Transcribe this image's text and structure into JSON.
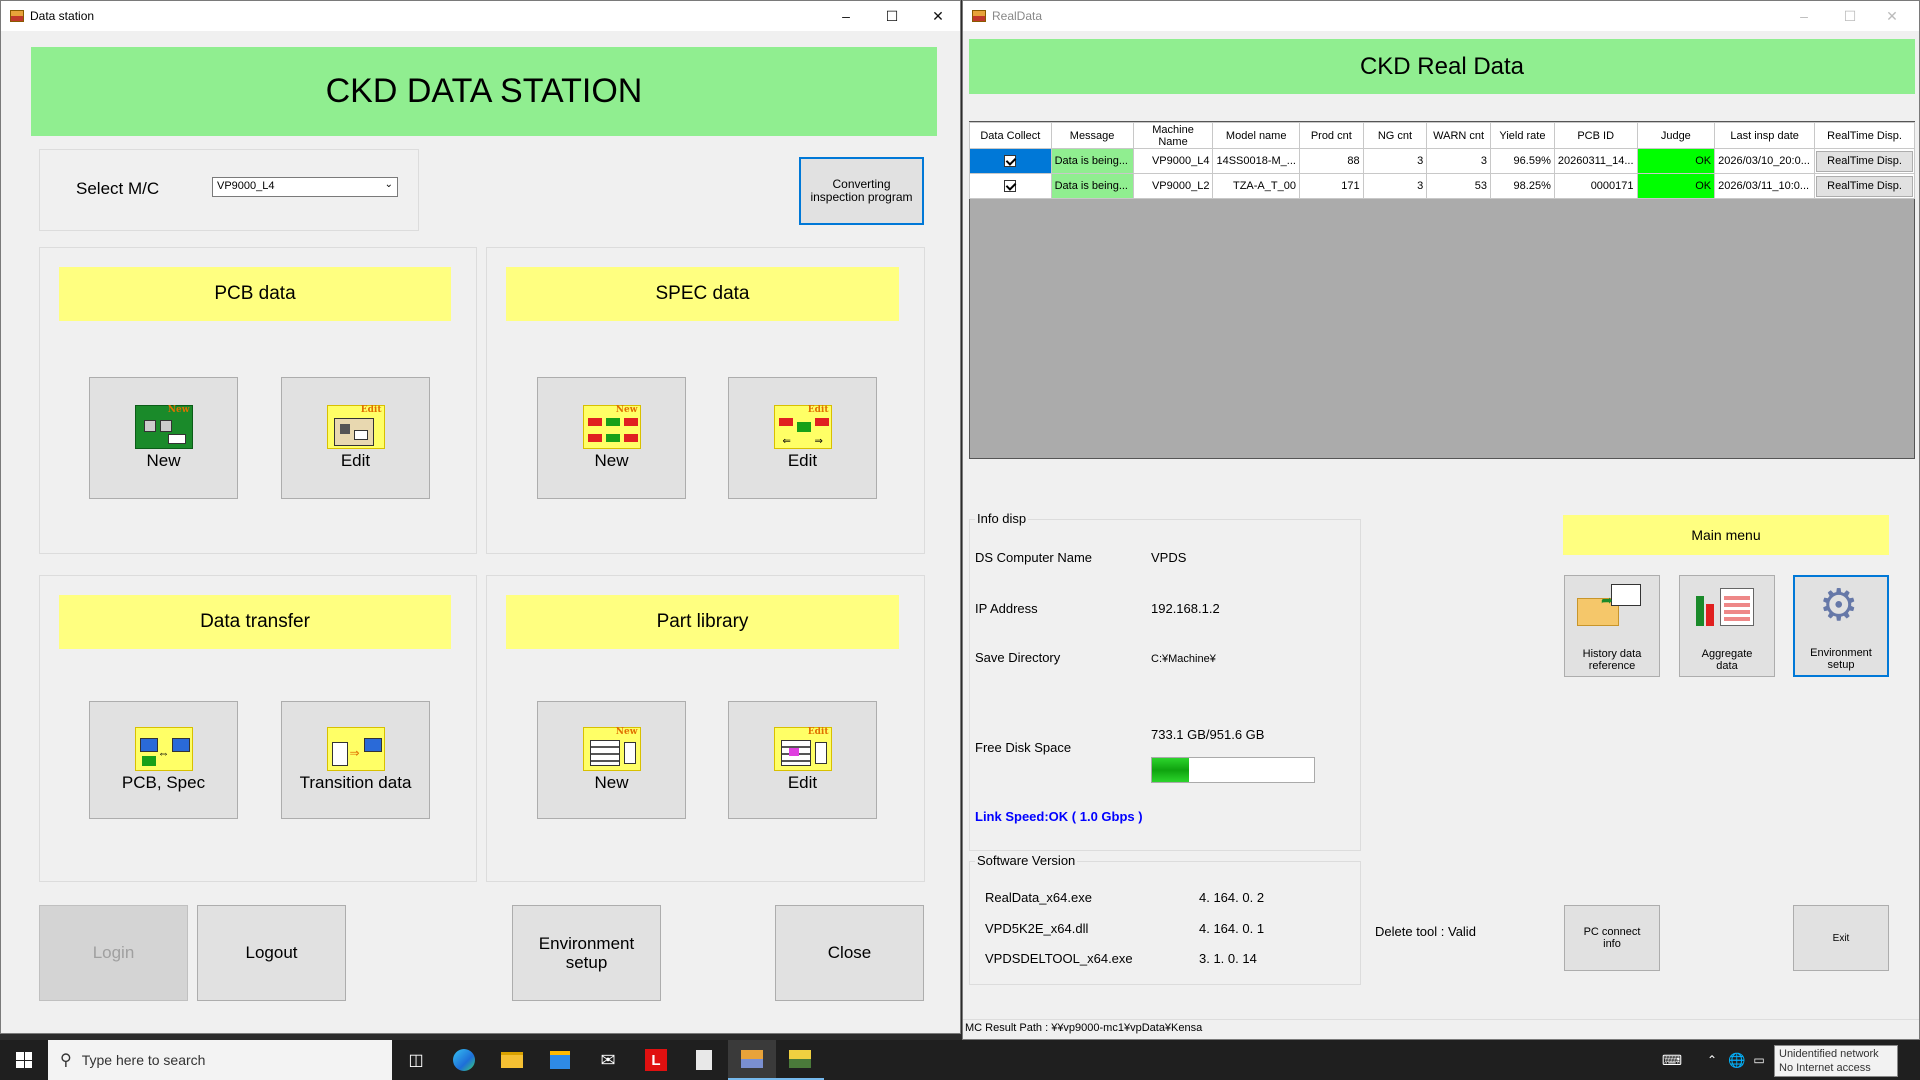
{
  "data_station": {
    "window_title": "Data station",
    "header": "CKD DATA STATION",
    "select_mc_label": "Select M/C",
    "select_mc_value": "VP9000_L4",
    "converting_label": "Converting\ninspection program",
    "pcb": {
      "title": "PCB data",
      "new": "New",
      "edit": "Edit"
    },
    "spec": {
      "title": "SPEC data",
      "new": "New",
      "edit": "Edit"
    },
    "transfer": {
      "title": "Data transfer",
      "pcb_spec": "PCB, Spec",
      "transition": "Transition data"
    },
    "library": {
      "title": "Part library",
      "new": "New",
      "edit": "Edit"
    },
    "bottom": {
      "login": "Login",
      "logout": "Logout",
      "env": "Environment\nsetup",
      "close": "Close"
    },
    "glyph_tags": {
      "new": "New",
      "edit": "Edit"
    }
  },
  "real_data": {
    "window_title": "RealData",
    "header": "CKD Real Data",
    "columns": [
      "Data Collect",
      "Message",
      "Machine\nName",
      "Model name",
      "Prod cnt",
      "NG cnt",
      "WARN cnt",
      "Yield rate",
      "PCB ID",
      "Judge",
      "Last insp date",
      "RealTime Disp."
    ],
    "rows": [
      {
        "message": "Data is being...",
        "machine": "VP9000_L4",
        "model": "14SS0018-M_...",
        "prod": "88",
        "ng": "3",
        "warn": "3",
        "yield": "96.59%",
        "pcb_id": "20260311_14...",
        "judge": "OK",
        "last": "2026/03/10_20:0...",
        "rt": "RealTime Disp."
      },
      {
        "message": "Data is being...",
        "machine": "VP9000_L2",
        "model": "TZA-A_T_00",
        "prod": "171",
        "ng": "3",
        "warn": "53",
        "yield": "98.25%",
        "pcb_id": "0000171",
        "judge": "OK",
        "last": "2026/03/11_10:0...",
        "rt": "RealTime Disp."
      }
    ],
    "info": {
      "title": "Info disp",
      "computer_label": "DS Computer Name",
      "computer_value": "VPDS",
      "ip_label": "IP Address",
      "ip_value": "192.168.1.2",
      "save_label": "Save Directory",
      "save_value": "C:¥Machine¥",
      "disk_label": "Free Disk Space",
      "disk_value": "733.1 GB/951.6 GB",
      "disk_used_fraction": 0.23,
      "link_speed": "Link Speed:OK ( 1.0 Gbps )"
    },
    "software": {
      "title": "Software Version",
      "items": [
        {
          "name": "RealData_x64.exe",
          "version": "4. 164. 0. 2"
        },
        {
          "name": "VPD5K2E_x64.dll",
          "version": "4. 164. 0. 1"
        },
        {
          "name": "VPDSDELTOOL_x64.exe",
          "version": "3. 1. 0. 14"
        }
      ]
    },
    "main_menu": {
      "title": "Main menu",
      "history": "History data\nreference",
      "aggregate": "Aggregate\ndata",
      "environment": "Environment\nsetup"
    },
    "delete_tool": "Delete tool : Valid",
    "pc_connect": "PC connect\ninfo",
    "exit": "Exit",
    "mc_result_path": "MC Result Path : ¥¥vp9000-mc1¥vpData¥Kensa"
  },
  "taskbar": {
    "search_placeholder": "Type here to search",
    "network_status_1": "Unidentified network",
    "network_status_2": "No Internet access"
  },
  "colors": {
    "green": "#90ee90",
    "yellow": "#ffff80",
    "judge_ok": "#00ff00",
    "select_blue": "#0078d7"
  }
}
